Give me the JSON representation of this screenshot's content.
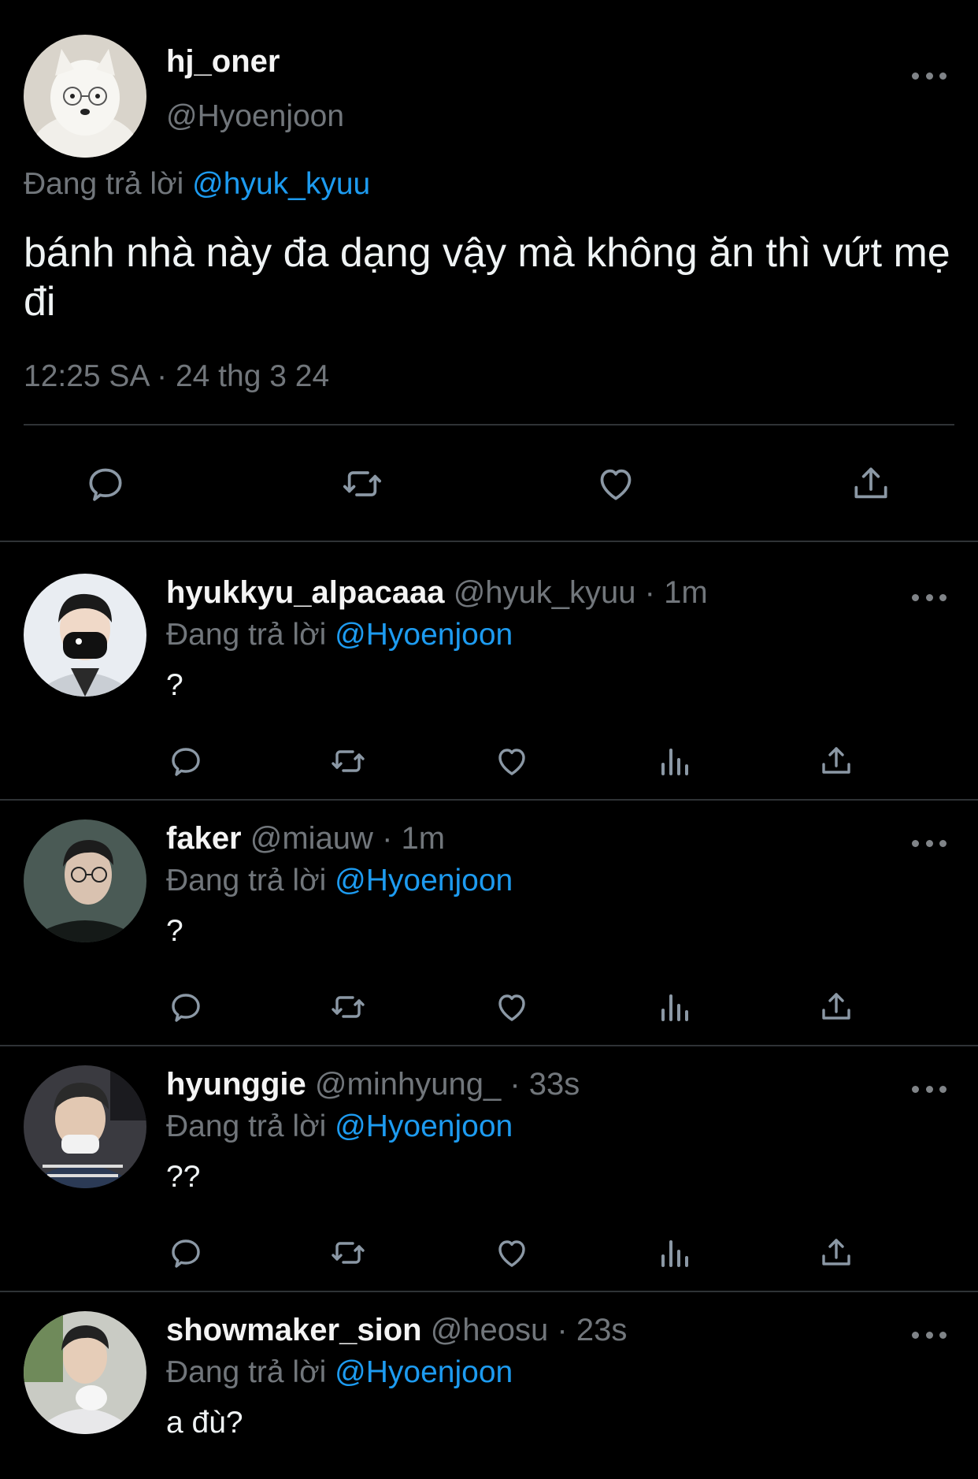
{
  "main_tweet": {
    "display_name": "hj_oner",
    "handle": "@Hyoenjoon",
    "replying_prefix": "Đang trả lời",
    "replying_to": "@hyuk_kyuu",
    "text": "bánh nhà này đa dạng vậy mà không ăn thì vứt mẹ đi",
    "timestamp": "12:25 SA · 24 thg 3 24",
    "actions": [
      "reply-icon",
      "retweet-icon",
      "like-icon",
      "share-icon"
    ]
  },
  "replies": [
    {
      "display_name": "hyukkyu_alpacaaa",
      "handle": "@hyuk_kyuu",
      "time": "· 1m",
      "replying_prefix": "Đang trả lời",
      "replying_to": "@Hyoenjoon",
      "text": "?"
    },
    {
      "display_name": "faker",
      "handle": "@miauw",
      "time": "· 1m",
      "replying_prefix": "Đang trả lời",
      "replying_to": "@Hyoenjoon",
      "text": "?"
    },
    {
      "display_name": "hyunggie",
      "handle": "@minhyung_",
      "time": "· 33s",
      "replying_prefix": "Đang trả lời",
      "replying_to": "@Hyoenjoon",
      "text": "??"
    },
    {
      "display_name": "showmaker_sion",
      "handle": "@heosu",
      "time": "· 23s",
      "replying_prefix": "Đang trả lời",
      "replying_to": "@Hyoenjoon",
      "text": "a đù?"
    }
  ],
  "colors": {
    "background": "#000000",
    "text": "#e7e9ea",
    "secondary": "#71767b",
    "mention": "#1d9bf0",
    "divider": "#2f3336"
  }
}
